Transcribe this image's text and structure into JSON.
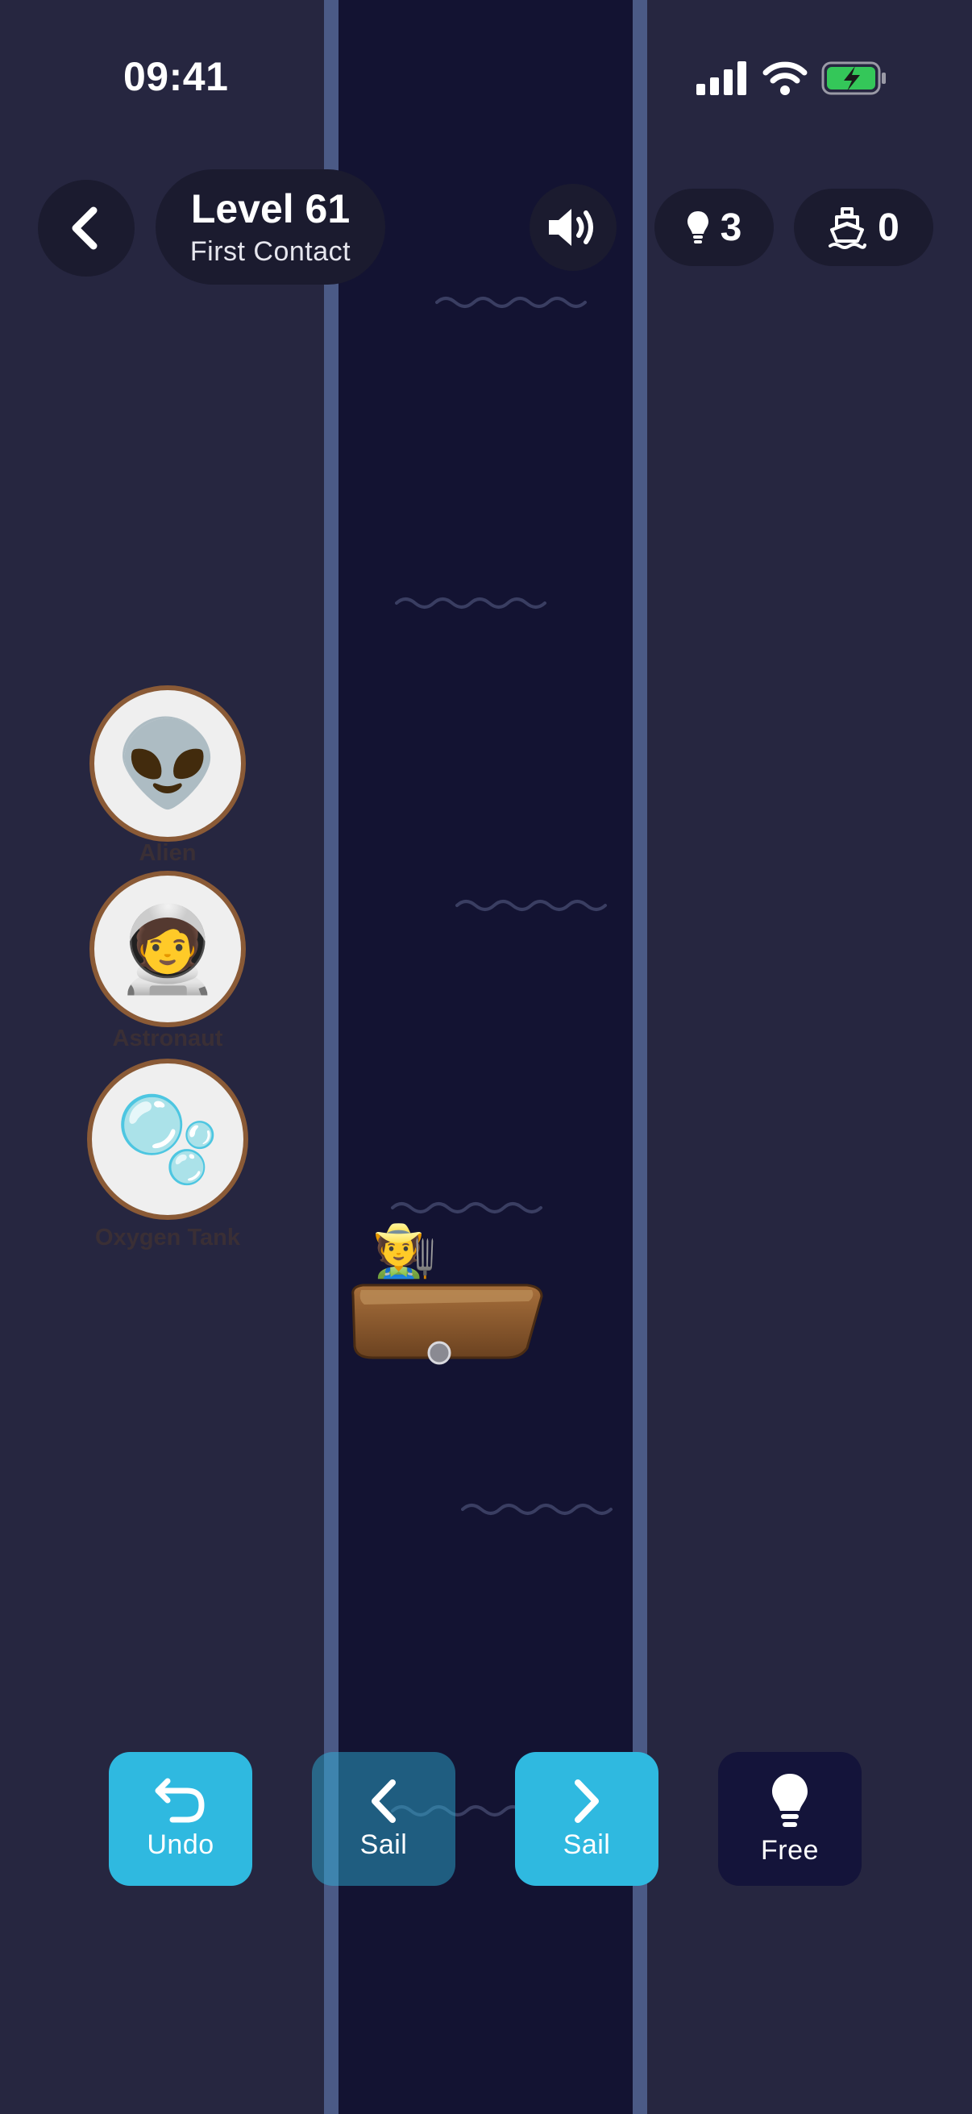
{
  "status_bar": {
    "time": "09:41",
    "icons": [
      "signal-icon",
      "wifi-icon",
      "battery-charging-icon"
    ],
    "battery_color": "#34c759"
  },
  "hud": {
    "back_icon": "chevron-left-icon",
    "level_title": "Level 61",
    "level_subtitle": "First Contact",
    "sound_icon": "speaker-on-icon",
    "hints": {
      "icon": "lightbulb-icon",
      "count": "3"
    },
    "trips": {
      "icon": "ship-icon",
      "count": "0"
    }
  },
  "left_bank": {
    "passengers": [
      {
        "emoji": "👽",
        "label": "Alien",
        "icon": "alien-icon"
      },
      {
        "emoji": "🧑‍🚀",
        "label": "Astronaut",
        "icon": "astronaut-icon"
      },
      {
        "emoji": "🫧",
        "label": "Oxygen Tank",
        "icon": "bubbles-icon"
      }
    ]
  },
  "boat": {
    "passenger_emoji": "🧑‍🌾",
    "passenger_icon": "farmer-icon",
    "side": "left"
  },
  "controls": {
    "undo_label": "Undo",
    "sail_left_label": "Sail",
    "sail_right_label": "Sail",
    "free_label": "Free"
  },
  "colors": {
    "bank": "#262640",
    "river": "#131332",
    "river_edge": "#4b5a86",
    "button_accent": "#2fb9e0",
    "circle_border": "#8a5a36"
  }
}
